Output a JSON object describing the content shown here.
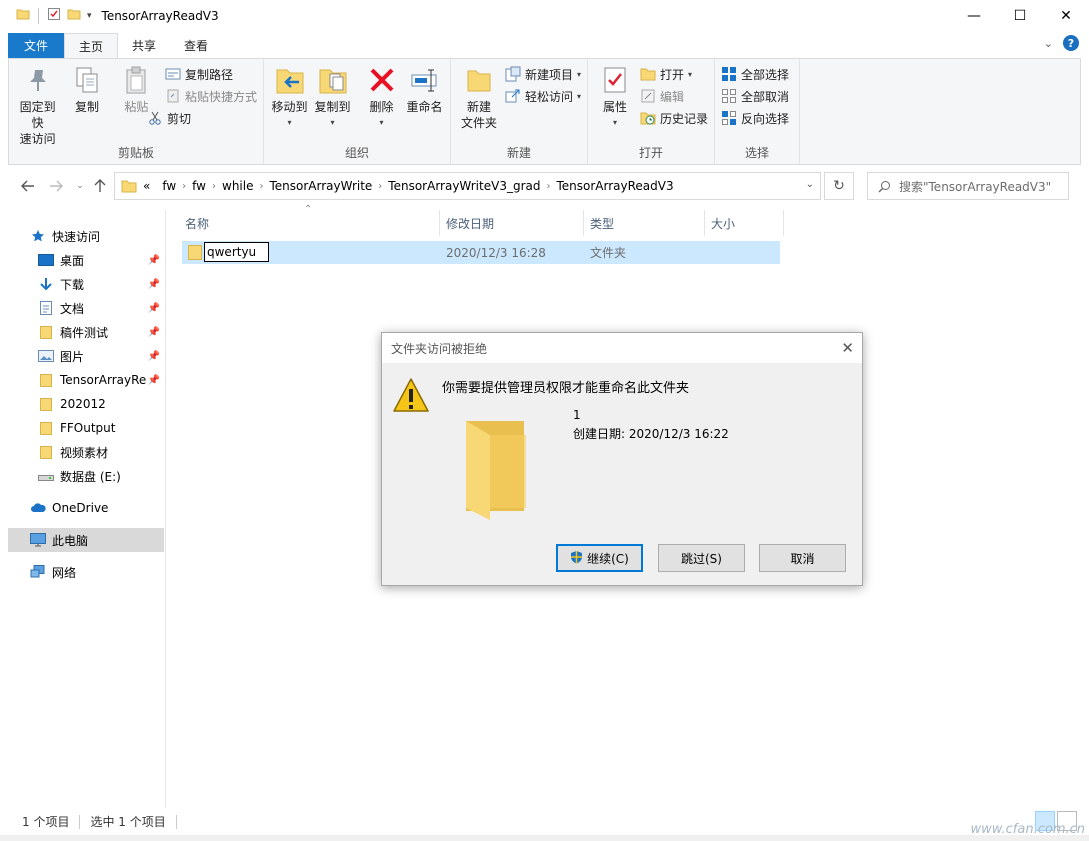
{
  "window": {
    "title": "TensorArrayReadV3",
    "controls": {
      "minimize": "—",
      "maximize": "☐",
      "close": "✕"
    }
  },
  "tabs": {
    "file": "文件",
    "home": "主页",
    "share": "共享",
    "view": "查看"
  },
  "ribbon": {
    "clipboard": {
      "label": "剪贴板",
      "pin_quick": "固定到快速访问",
      "pin_quick_line1": "固定到快",
      "pin_quick_line2": "速访问",
      "copy": "复制",
      "paste": "粘贴",
      "copy_path": "复制路径",
      "paste_shortcut": "粘贴快捷方式",
      "cut": "剪切"
    },
    "organize": {
      "label": "组织",
      "move_to": "移动到",
      "copy_to": "复制到",
      "delete": "删除",
      "rename": "重命名"
    },
    "new": {
      "label": "新建",
      "new_folder_line1": "新建",
      "new_folder_line2": "文件夹",
      "new_item": "新建项目",
      "easy_access": "轻松访问"
    },
    "open": {
      "label": "打开",
      "properties": "属性",
      "open": "打开",
      "edit": "编辑",
      "history": "历史记录"
    },
    "select": {
      "label": "选择",
      "select_all": "全部选择",
      "select_none": "全部取消",
      "invert": "反向选择"
    }
  },
  "address": {
    "prefix": "«",
    "crumbs": [
      "fw",
      "fw",
      "while",
      "TensorArrayWrite",
      "TensorArrayWriteV3_grad",
      "TensorArrayReadV3"
    ]
  },
  "search": {
    "placeholder": "搜索\"TensorArrayReadV3\""
  },
  "nav": {
    "quick_access": "快速访问",
    "items": [
      {
        "label": "桌面",
        "pinned": true
      },
      {
        "label": "下载",
        "pinned": true
      },
      {
        "label": "文档",
        "pinned": true
      },
      {
        "label": "稿件测试",
        "pinned": true
      },
      {
        "label": "图片",
        "pinned": true
      },
      {
        "label": "TensorArrayRe",
        "pinned": true
      },
      {
        "label": "202012",
        "pinned": false
      },
      {
        "label": "FFOutput",
        "pinned": false
      },
      {
        "label": "视频素材",
        "pinned": false
      },
      {
        "label": "数据盘 (E:)",
        "pinned": false
      }
    ],
    "onedrive": "OneDrive",
    "this_pc": "此电脑",
    "network": "网络"
  },
  "columns": {
    "name": "名称",
    "modified": "修改日期",
    "type": "类型",
    "size": "大小"
  },
  "files": [
    {
      "name": "qwertyu",
      "modified": "2020/12/3 16:28",
      "type": "文件夹",
      "size": ""
    }
  ],
  "status": {
    "count": "1 个项目",
    "selected": "选中 1 个项目"
  },
  "dialog": {
    "title": "文件夹访问被拒绝",
    "message": "你需要提供管理员权限才能重命名此文件夹",
    "folder_name": "1",
    "created": "创建日期: 2020/12/3 16:22",
    "continue": "继续(C)",
    "skip": "跳过(S)",
    "cancel": "取消"
  },
  "watermark": "www.cfan.com.cn",
  "colors": {
    "accent": "#1979ca",
    "selection": "#cce8ff",
    "folder": "#f8d775",
    "warning": "#f5c518",
    "delete": "#e81123"
  }
}
